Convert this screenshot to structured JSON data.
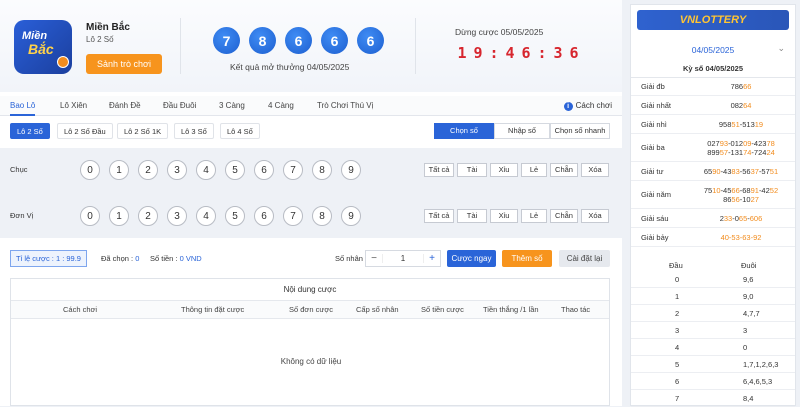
{
  "header": {
    "logo_top": "Miền",
    "logo_bottom": "Bắc",
    "region": "Miền Bắc",
    "game": "Lô 2 Số",
    "lobby_button": "Sảnh trò chơi",
    "result_balls": [
      "7",
      "8",
      "6",
      "6",
      "6"
    ],
    "result_caption": "Kết quả mở thưởng 04/05/2025",
    "stop_caption": "Dừng cược 05/05/2025",
    "countdown": [
      "1",
      "9",
      ":",
      "4",
      "6",
      ":",
      "3",
      "6"
    ]
  },
  "tabs": [
    "Bao Lô",
    "Lô Xiên",
    "Đánh Đề",
    "Đầu Đuôi",
    "3 Càng",
    "4 Càng",
    "Trò Chơi Thú Vị"
  ],
  "active_tab": "Bao Lô",
  "how_to": "Cách chơi",
  "subtabs": [
    "Lô 2 Số",
    "Lô 2 Số Đầu",
    "Lô 2 Số 1K",
    "Lô 3 Số",
    "Lô 4 Số"
  ],
  "modes": [
    "Chọn số",
    "Nhập số",
    "Chọn số nhanh"
  ],
  "rows": [
    {
      "label": "Chục",
      "numbers": [
        "0",
        "1",
        "2",
        "3",
        "4",
        "5",
        "6",
        "7",
        "8",
        "9"
      ]
    },
    {
      "label": "Đơn Vị",
      "numbers": [
        "0",
        "1",
        "2",
        "3",
        "4",
        "5",
        "6",
        "7",
        "8",
        "9"
      ]
    }
  ],
  "quick_buttons": [
    "Tất cả",
    "Tài",
    "Xỉu",
    "Lẻ",
    "Chẵn",
    "Xóa"
  ],
  "bet": {
    "ratio": "Tỉ lệ cược : 1 : 99.9",
    "picked_label": "Đã chọn :",
    "picked_value": "0",
    "money_label": "Số tiền :",
    "money_value": "0 VND",
    "multiplier_label": "Số nhân :",
    "multiplier_value": "1",
    "minus": "−",
    "plus": "+",
    "quick_bet": "Cược ngay",
    "add_number": "Thêm số",
    "reset": "Cài đặt lại"
  },
  "bet_table": {
    "title": "Nội dung cược",
    "columns": [
      "Cách chơi",
      "Thông tin đặt cược",
      "Số đơn cược",
      "Cấp số nhân",
      "Số tiền cược",
      "Tiền thắng /1 lần",
      "Thao tác"
    ],
    "empty": "Không có dữ liệu"
  },
  "sidebar": {
    "brand": "VNLOTTERY",
    "date": "04/05/2025",
    "draw_title": "Kỳ số 04/05/2025",
    "prizes": [
      {
        "name": "Giải đb",
        "lines": [
          [
            [
              "786",
              false
            ],
            [
              "66",
              true
            ]
          ]
        ]
      },
      {
        "name": "Giải nhất",
        "lines": [
          [
            [
              "082",
              false
            ],
            [
              "64",
              true
            ]
          ]
        ]
      },
      {
        "name": "Giải nhì",
        "lines": [
          [
            [
              "958",
              false
            ],
            [
              "51",
              true
            ],
            [
              "-513",
              false
            ],
            [
              "19",
              true
            ]
          ]
        ]
      },
      {
        "name": "Giải ba",
        "lines": [
          [
            [
              "027",
              false
            ],
            [
              "93",
              true
            ],
            [
              "-012",
              false
            ],
            [
              "09",
              true
            ],
            [
              "-423",
              false
            ],
            [
              "78",
              true
            ]
          ],
          [
            [
              "899",
              false
            ],
            [
              "57",
              true
            ],
            [
              "-131",
              false
            ],
            [
              "74",
              true
            ],
            [
              "-724",
              false
            ],
            [
              "24",
              true
            ]
          ]
        ]
      },
      {
        "name": "Giải tư",
        "lines": [
          [
            [
              "65",
              false
            ],
            [
              "90",
              true
            ],
            [
              "-43",
              false
            ],
            [
              "83",
              true
            ],
            [
              "-56",
              false
            ],
            [
              "37",
              true
            ],
            [
              "-57",
              false
            ],
            [
              "51",
              true
            ]
          ]
        ]
      },
      {
        "name": "Giải năm",
        "lines": [
          [
            [
              "75",
              false
            ],
            [
              "10",
              true
            ],
            [
              "-45",
              false
            ],
            [
              "66",
              true
            ],
            [
              "-68",
              false
            ],
            [
              "91",
              true
            ],
            [
              "-42",
              false
            ],
            [
              "52",
              true
            ]
          ],
          [
            [
              "86",
              false
            ],
            [
              "56",
              true
            ],
            [
              "-10",
              false
            ],
            [
              "27",
              true
            ]
          ]
        ]
      },
      {
        "name": "Giải sáu",
        "lines": [
          [
            [
              "2",
              false
            ],
            [
              "33",
              true
            ],
            [
              "-0",
              false
            ],
            [
              "65",
              true
            ],
            [
              "-",
              false
            ],
            [
              "606",
              true
            ]
          ]
        ]
      },
      {
        "name": "Giải bảy",
        "lines": [
          [
            [
              "40-53-63-92",
              true
            ]
          ]
        ]
      }
    ],
    "head_col": "Đầu",
    "tail_col": "Đuôi",
    "headtail": [
      [
        "0",
        "9,6"
      ],
      [
        "1",
        "9,0"
      ],
      [
        "2",
        "4,7,7"
      ],
      [
        "3",
        "3"
      ],
      [
        "4",
        "0"
      ],
      [
        "5",
        "1,7,1,2,6,3"
      ],
      [
        "6",
        "6,4,6,5,3"
      ],
      [
        "7",
        "8,4"
      ]
    ]
  }
}
